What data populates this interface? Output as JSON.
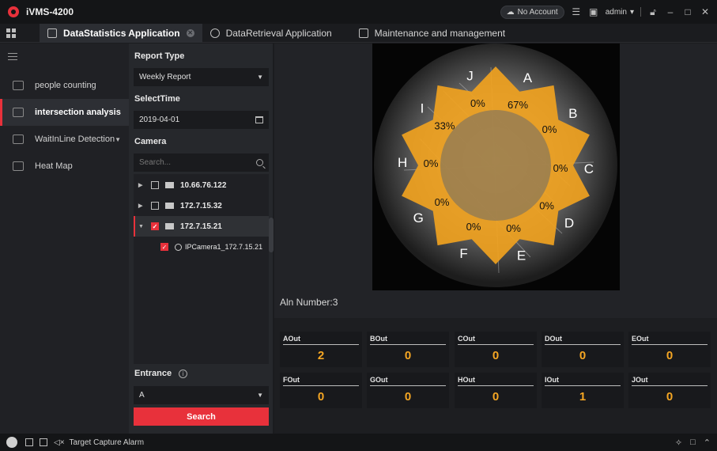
{
  "app": {
    "title": "iVMS-4200"
  },
  "titlebar": {
    "account_label": "No Account",
    "user": "admin"
  },
  "tabs": [
    {
      "label": "DataStatistics Application"
    },
    {
      "label": "DataRetrieval Application"
    },
    {
      "label": "Maintenance and management"
    }
  ],
  "nav": {
    "items": [
      {
        "label": "people counting"
      },
      {
        "label": "intersection analysis"
      },
      {
        "label": "WaitInLine Detection"
      },
      {
        "label": "Heat Map"
      }
    ]
  },
  "filters": {
    "report_type_label": "Report Type",
    "report_type_value": "Weekly Report",
    "select_time_label": "SelectTime",
    "select_time_value": "2019-04-01",
    "camera_label": "Camera",
    "search_placeholder": "Search...",
    "tree": [
      {
        "label": "10.66.76.122"
      },
      {
        "label": "172.7.15.32"
      },
      {
        "label": "172.7.15.21"
      },
      {
        "label": "IPCamera1_172.7.15.21"
      }
    ],
    "entrance_label": "Entrance",
    "entrance_value": "A",
    "search_button": "Search"
  },
  "video": {
    "zones": [
      {
        "letter": "A",
        "pct": "67%"
      },
      {
        "letter": "B",
        "pct": "0%"
      },
      {
        "letter": "C",
        "pct": "0%"
      },
      {
        "letter": "D",
        "pct": "0%"
      },
      {
        "letter": "E",
        "pct": "0%"
      },
      {
        "letter": "F",
        "pct": "0%"
      },
      {
        "letter": "G",
        "pct": "0%"
      },
      {
        "letter": "H",
        "pct": "0%"
      },
      {
        "letter": "I",
        "pct": "33%"
      },
      {
        "letter": "J",
        "pct": "0%"
      }
    ],
    "overlay_color": "#f0a21f"
  },
  "aln_number": "Aln Number:3",
  "stats": [
    {
      "title": "AOut",
      "value": "2"
    },
    {
      "title": "BOut",
      "value": "0"
    },
    {
      "title": "COut",
      "value": "0"
    },
    {
      "title": "DOut",
      "value": "0"
    },
    {
      "title": "EOut",
      "value": "0"
    },
    {
      "title": "FOut",
      "value": "0"
    },
    {
      "title": "GOut",
      "value": "0"
    },
    {
      "title": "HOut",
      "value": "0"
    },
    {
      "title": "IOut",
      "value": "1"
    },
    {
      "title": "JOut",
      "value": "0"
    }
  ],
  "statusbar": {
    "alarm_label": "Target Capture Alarm"
  }
}
